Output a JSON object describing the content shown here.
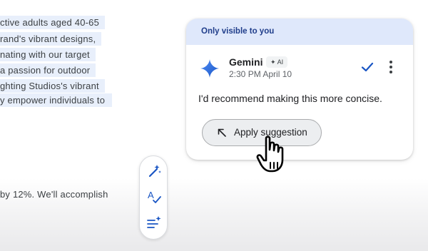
{
  "document": {
    "lines": [
      "ctive adults aged 40-65",
      "rand's vibrant designs,",
      "nating with our target",
      "a passion for outdoor",
      "ghting Studios's vibrant",
      "y empower individuals to"
    ],
    "bottom_line": "by 12%. We'll accomplish"
  },
  "suggestion_card": {
    "visibility_note": "Only visible to you",
    "author": "Gemini",
    "ai_badge": "AI",
    "timestamp": "2:30 PM April 10",
    "message": "I'd recommend making this more concise.",
    "apply_label": "Apply suggestion"
  },
  "toolbar": {
    "items": [
      "magic-rewrite-icon",
      "spell-check-icon",
      "refine-text-icon"
    ]
  },
  "colors": {
    "accent": "#1a56c4",
    "header_bg": "#dfe8fb",
    "highlight": "#e8effb"
  }
}
